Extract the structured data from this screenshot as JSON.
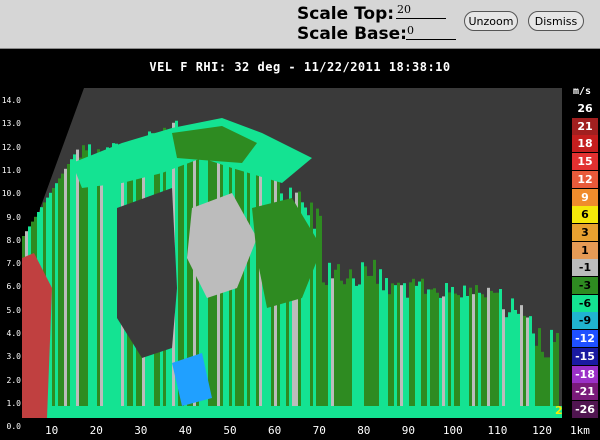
{
  "toolbar": {
    "scale_top_label": "Scale Top:",
    "scale_top_value": "20",
    "scale_base_label": "Scale Base:",
    "scale_base_value": "0",
    "unzoom_label": "Unzoom",
    "dismiss_label": "Dismiss"
  },
  "plot": {
    "title": "VEL F  RHI: 32 deg  -  11/22/2011 18:38:10",
    "y_ticks": [
      "14.0",
      "13.0",
      "12.0",
      "11.0",
      "10.0",
      "9.0",
      "8.0",
      "7.0",
      "6.0",
      "5.0",
      "4.0",
      "3.0",
      "2.0",
      "1.0",
      "0.0"
    ],
    "x_ticks": [
      "10",
      "20",
      "30",
      "40",
      "50",
      "60",
      "70",
      "80",
      "90",
      "100",
      "110",
      "120"
    ],
    "x_end_label": "1km",
    "corner_label": "2",
    "colors": {
      "background": "#3a3a3a",
      "green": "#2e8b21",
      "aqua": "#14e392",
      "gray": "#bcbcbc",
      "blue": "#20a0ff"
    }
  },
  "legend": {
    "unit": "m/s",
    "items": [
      {
        "label": "26",
        "color": "#000000",
        "text": "#ffffff"
      },
      {
        "label": "21",
        "color": "#a11f1f",
        "text": "#ffffff"
      },
      {
        "label": "18",
        "color": "#c41e1e",
        "text": "#ffffff"
      },
      {
        "label": "15",
        "color": "#e23030",
        "text": "#ffffff"
      },
      {
        "label": "12",
        "color": "#e85a3a",
        "text": "#ffffff"
      },
      {
        "label": "9",
        "color": "#f08c2c",
        "text": "#ffffff"
      },
      {
        "label": "6",
        "color": "#f5e80a",
        "text": "#000000"
      },
      {
        "label": "3",
        "color": "#e8a030",
        "text": "#000000"
      },
      {
        "label": "1",
        "color": "#e59a55",
        "text": "#000000"
      },
      {
        "label": "-1",
        "color": "#bcbcbc",
        "text": "#000000"
      },
      {
        "label": "-3",
        "color": "#2e8b21",
        "text": "#000000"
      },
      {
        "label": "-6",
        "color": "#14e392",
        "text": "#000000"
      },
      {
        "label": "-9",
        "color": "#20b4d0",
        "text": "#000000"
      },
      {
        "label": "-12",
        "color": "#1e50ff",
        "text": "#ffffff"
      },
      {
        "label": "-15",
        "color": "#1a1aa0",
        "text": "#ffffff"
      },
      {
        "label": "-18",
        "color": "#9b30c8",
        "text": "#ffffff"
      },
      {
        "label": "-21",
        "color": "#7a1a7a",
        "text": "#ffffff"
      },
      {
        "label": "-26",
        "color": "#501550",
        "text": "#ffffff"
      }
    ]
  }
}
